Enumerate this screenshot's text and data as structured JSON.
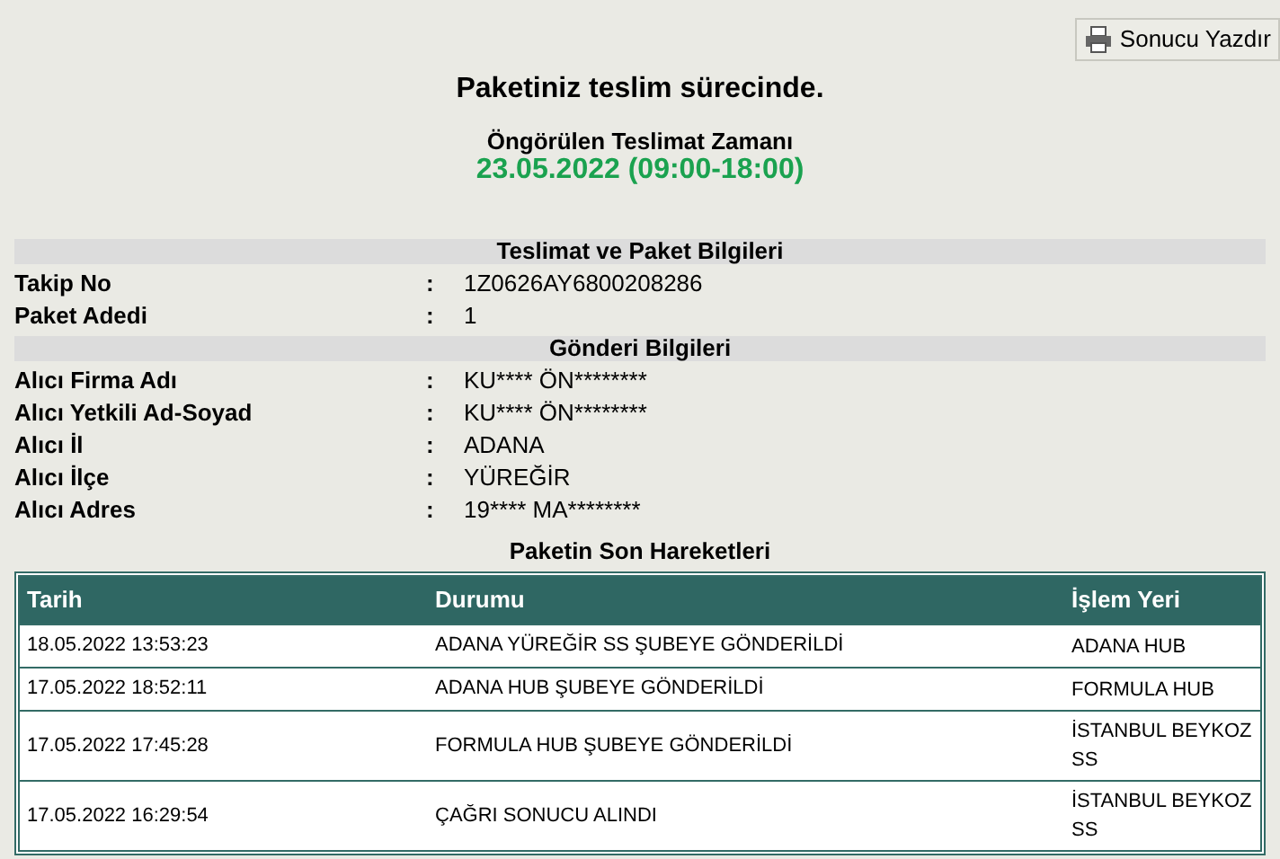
{
  "print_button": {
    "label": "Sonucu Yazdır"
  },
  "status_title": "Paketiniz teslim sürecinde.",
  "delivery": {
    "label": "Öngörülen Teslimat Zamanı",
    "value": "23.05.2022 (09:00-18:00)"
  },
  "sections": [
    {
      "title": "Teslimat ve Paket Bilgileri",
      "fields": [
        {
          "label": "Takip No",
          "separator": ":",
          "value": "1Z0626AY6800208286"
        },
        {
          "label": "Paket Adedi",
          "separator": ":",
          "value": "1"
        }
      ]
    },
    {
      "title": "Gönderi Bilgileri",
      "fields": [
        {
          "label": "Alıcı Firma Adı",
          "separator": ":",
          "value": "KU**** ÖN********"
        },
        {
          "label": "Alıcı Yetkili Ad-Soyad",
          "separator": ":",
          "value": "KU**** ÖN********"
        },
        {
          "label": "Alıcı İl",
          "separator": ":",
          "value": "ADANA"
        },
        {
          "label": "Alıcı İlçe",
          "separator": ":",
          "value": "YÜREĞİR"
        },
        {
          "label": "Alıcı Adres",
          "separator": ":",
          "value": "19**** MA********"
        }
      ]
    }
  ],
  "movements": {
    "title": "Paketin Son Hareketleri",
    "columns": [
      "Tarih",
      "Durumu",
      "İşlem Yeri"
    ],
    "rows": [
      [
        "18.05.2022 13:53:23",
        "ADANA YÜREĞİR SS ŞUBEYE GÖNDERİLDİ",
        "ADANA HUB"
      ],
      [
        "17.05.2022 18:52:11",
        "ADANA HUB ŞUBEYE GÖNDERİLDİ",
        "FORMULA HUB"
      ],
      [
        "17.05.2022 17:45:28",
        "FORMULA HUB ŞUBEYE GÖNDERİLDİ",
        "İSTANBUL BEYKOZ SS"
      ],
      [
        "17.05.2022 16:29:54",
        "ÇAĞRI SONUCU ALINDI",
        "İSTANBUL BEYKOZ SS"
      ]
    ]
  }
}
